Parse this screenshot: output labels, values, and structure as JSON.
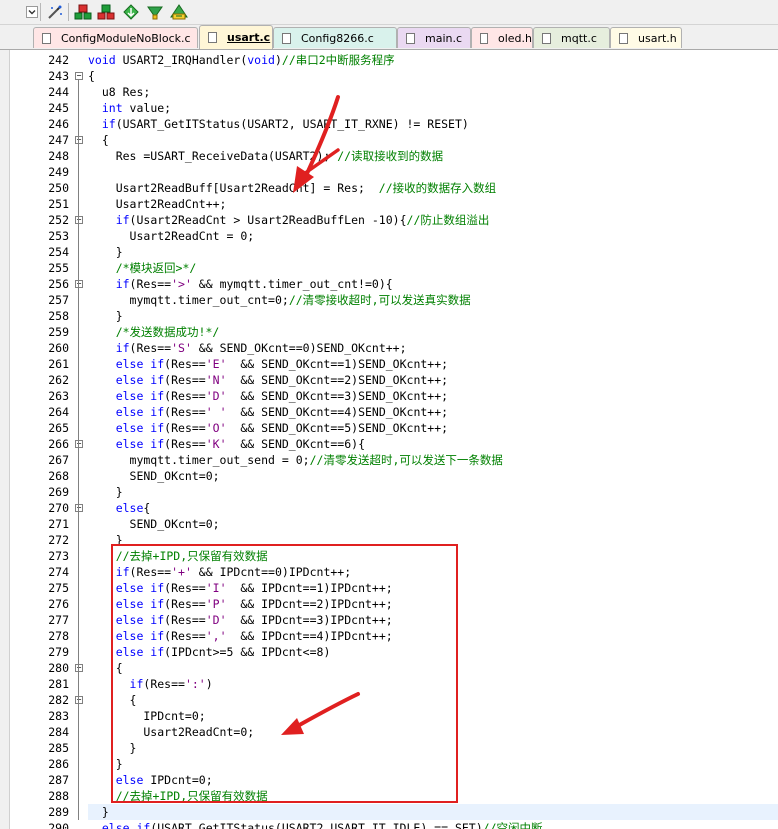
{
  "toolbar": {
    "icons": [
      "chevron-down-icon",
      "magic-wand-icon",
      "build-icon",
      "rebuild-icon",
      "download-icon",
      "debug-icon",
      "options-icon"
    ]
  },
  "tabs": [
    {
      "label": "ConfigModuleNoBlock.c",
      "color": "#ffe6e6",
      "active": false
    },
    {
      "label": "usart.c",
      "color": "#fff6d7",
      "active": true
    },
    {
      "label": "Config8266.c",
      "color": "#d9f2ec",
      "active": false
    },
    {
      "label": "main.c",
      "color": "#ead9f2",
      "active": false
    },
    {
      "label": "oled.h",
      "color": "#ffe6e6",
      "active": false
    },
    {
      "label": "mqtt.c",
      "color": "#e6eedd",
      "active": false
    },
    {
      "label": "usart.h",
      "color": "#fffbe6",
      "active": false
    }
  ],
  "editor": {
    "current_line": 289,
    "lines": [
      {
        "n": "242",
        "fold": "",
        "segs": [
          [
            "kw",
            "void "
          ],
          [
            "",
            "USART2_IRQHandler("
          ],
          [
            "kw",
            "void"
          ],
          [
            "",
            ")"
          ],
          [
            "cm",
            "//串口2中断服务程序"
          ]
        ]
      },
      {
        "n": "243",
        "fold": "-",
        "segs": [
          [
            "",
            "{"
          ]
        ]
      },
      {
        "n": "244",
        "fold": "",
        "segs": [
          [
            "",
            "  u8 Res;"
          ]
        ]
      },
      {
        "n": "245",
        "fold": "",
        "segs": [
          [
            "kw",
            "  int "
          ],
          [
            "",
            "value;"
          ]
        ]
      },
      {
        "n": "246",
        "fold": "",
        "segs": [
          [
            "kw",
            "  if"
          ],
          [
            "",
            "(USART_GetITStatus(USART2, USART_IT_RXNE) != RESET)"
          ]
        ]
      },
      {
        "n": "247",
        "fold": "-",
        "segs": [
          [
            "",
            "  {"
          ]
        ]
      },
      {
        "n": "248",
        "fold": "",
        "segs": [
          [
            "",
            "    Res =USART_ReceiveData(USART2); "
          ],
          [
            "cm",
            "//读取接收到的数据"
          ]
        ]
      },
      {
        "n": "249",
        "fold": "",
        "segs": [
          [
            "",
            ""
          ]
        ]
      },
      {
        "n": "250",
        "fold": "",
        "segs": [
          [
            "",
            "    Usart2ReadBuff[Usart2ReadCnt] = Res;  "
          ],
          [
            "cm",
            "//接收的数据存入数组"
          ]
        ]
      },
      {
        "n": "251",
        "fold": "",
        "segs": [
          [
            "",
            "    Usart2ReadCnt++;"
          ]
        ]
      },
      {
        "n": "252",
        "fold": "-",
        "segs": [
          [
            "kw",
            "    if"
          ],
          [
            "",
            "(Usart2ReadCnt > Usart2ReadBuffLen -"
          ],
          [
            "num",
            "10"
          ],
          [
            "",
            ")"
          ],
          [
            "",
            "{"
          ],
          [
            "cm",
            "//防止数组溢出"
          ]
        ]
      },
      {
        "n": "253",
        "fold": "",
        "segs": [
          [
            "",
            "      Usart2ReadCnt = "
          ],
          [
            "num",
            "0"
          ],
          [
            "",
            ";"
          ]
        ]
      },
      {
        "n": "254",
        "fold": "",
        "segs": [
          [
            "",
            "    }"
          ]
        ]
      },
      {
        "n": "255",
        "fold": "",
        "segs": [
          [
            "cm",
            "    /*模块返回>*/"
          ]
        ]
      },
      {
        "n": "256",
        "fold": "-",
        "segs": [
          [
            "kw",
            "    if"
          ],
          [
            "",
            "(Res=="
          ],
          [
            "str",
            "'>'"
          ],
          [
            "",
            " && mymqtt.timer_out_cnt!="
          ],
          [
            "num",
            "0"
          ],
          [
            "",
            ")"
          ],
          [
            "",
            "{"
          ]
        ]
      },
      {
        "n": "257",
        "fold": "",
        "segs": [
          [
            "",
            "      mymqtt.timer_out_cnt="
          ],
          [
            "num",
            "0"
          ],
          [
            "",
            ";"
          ],
          [
            "cm",
            "//清零接收超时,可以发送真实数据"
          ]
        ]
      },
      {
        "n": "258",
        "fold": "",
        "segs": [
          [
            "",
            "    }"
          ]
        ]
      },
      {
        "n": "259",
        "fold": "",
        "segs": [
          [
            "cm",
            "    /*发送数据成功!*/"
          ]
        ]
      },
      {
        "n": "260",
        "fold": "",
        "segs": [
          [
            "kw",
            "    if"
          ],
          [
            "",
            "(Res=="
          ],
          [
            "str",
            "'S'"
          ],
          [
            "",
            " && SEND_OKcnt=="
          ],
          [
            "num",
            "0"
          ],
          [
            "",
            ")SEND_OKcnt++;"
          ]
        ]
      },
      {
        "n": "261",
        "fold": "",
        "segs": [
          [
            "kw",
            "    else if"
          ],
          [
            "",
            "(Res=="
          ],
          [
            "str",
            "'E'"
          ],
          [
            "",
            "  && SEND_OKcnt=="
          ],
          [
            "num",
            "1"
          ],
          [
            "",
            ")SEND_OKcnt++;"
          ]
        ]
      },
      {
        "n": "262",
        "fold": "",
        "segs": [
          [
            "kw",
            "    else if"
          ],
          [
            "",
            "(Res=="
          ],
          [
            "str",
            "'N'"
          ],
          [
            "",
            "  && SEND_OKcnt=="
          ],
          [
            "num",
            "2"
          ],
          [
            "",
            ")SEND_OKcnt++;"
          ]
        ]
      },
      {
        "n": "263",
        "fold": "",
        "segs": [
          [
            "kw",
            "    else if"
          ],
          [
            "",
            "(Res=="
          ],
          [
            "str",
            "'D'"
          ],
          [
            "",
            "  && SEND_OKcnt=="
          ],
          [
            "num",
            "3"
          ],
          [
            "",
            ")SEND_OKcnt++;"
          ]
        ]
      },
      {
        "n": "264",
        "fold": "",
        "segs": [
          [
            "kw",
            "    else if"
          ],
          [
            "",
            "(Res=="
          ],
          [
            "str",
            "' '"
          ],
          [
            "",
            "  && SEND_OKcnt=="
          ],
          [
            "num",
            "4"
          ],
          [
            "",
            ")SEND_OKcnt++;"
          ]
        ]
      },
      {
        "n": "265",
        "fold": "",
        "segs": [
          [
            "kw",
            "    else if"
          ],
          [
            "",
            "(Res=="
          ],
          [
            "str",
            "'O'"
          ],
          [
            "",
            "  && SEND_OKcnt=="
          ],
          [
            "num",
            "5"
          ],
          [
            "",
            ")SEND_OKcnt++;"
          ]
        ]
      },
      {
        "n": "266",
        "fold": "-",
        "segs": [
          [
            "kw",
            "    else if"
          ],
          [
            "",
            "(Res=="
          ],
          [
            "str",
            "'K'"
          ],
          [
            "",
            "  && SEND_OKcnt=="
          ],
          [
            "num",
            "6"
          ],
          [
            "",
            ")"
          ],
          [
            "",
            "{"
          ]
        ]
      },
      {
        "n": "267",
        "fold": "",
        "segs": [
          [
            "",
            "      mymqtt.timer_out_send = "
          ],
          [
            "num",
            "0"
          ],
          [
            "",
            ";"
          ],
          [
            "cm",
            "//清零发送超时,可以发送下一条数据"
          ]
        ]
      },
      {
        "n": "268",
        "fold": "",
        "segs": [
          [
            "",
            "      SEND_OKcnt="
          ],
          [
            "num",
            "0"
          ],
          [
            "",
            ";"
          ]
        ]
      },
      {
        "n": "269",
        "fold": "",
        "segs": [
          [
            "",
            "    }"
          ]
        ]
      },
      {
        "n": "270",
        "fold": "-",
        "segs": [
          [
            "kw",
            "    else"
          ],
          [
            "",
            "{"
          ]
        ]
      },
      {
        "n": "271",
        "fold": "",
        "segs": [
          [
            "",
            "      SEND_OKcnt="
          ],
          [
            "num",
            "0"
          ],
          [
            "",
            ";"
          ]
        ]
      },
      {
        "n": "272",
        "fold": "",
        "segs": [
          [
            "",
            "    }"
          ]
        ]
      },
      {
        "n": "273",
        "fold": "",
        "segs": [
          [
            "cm",
            "    //去掉+IPD,只保留有效数据"
          ]
        ]
      },
      {
        "n": "274",
        "fold": "",
        "segs": [
          [
            "kw",
            "    if"
          ],
          [
            "",
            "(Res=="
          ],
          [
            "str",
            "'+'"
          ],
          [
            "",
            " && IPDcnt=="
          ],
          [
            "num",
            "0"
          ],
          [
            "",
            ")IPDcnt++;"
          ]
        ]
      },
      {
        "n": "275",
        "fold": "",
        "segs": [
          [
            "kw",
            "    else if"
          ],
          [
            "",
            "(Res=="
          ],
          [
            "str",
            "'I'"
          ],
          [
            "",
            "  && IPDcnt=="
          ],
          [
            "num",
            "1"
          ],
          [
            "",
            ")IPDcnt++;"
          ]
        ]
      },
      {
        "n": "276",
        "fold": "",
        "segs": [
          [
            "kw",
            "    else if"
          ],
          [
            "",
            "(Res=="
          ],
          [
            "str",
            "'P'"
          ],
          [
            "",
            "  && IPDcnt=="
          ],
          [
            "num",
            "2"
          ],
          [
            "",
            ")IPDcnt++;"
          ]
        ]
      },
      {
        "n": "277",
        "fold": "",
        "segs": [
          [
            "kw",
            "    else if"
          ],
          [
            "",
            "(Res=="
          ],
          [
            "str",
            "'D'"
          ],
          [
            "",
            "  && IPDcnt=="
          ],
          [
            "num",
            "3"
          ],
          [
            "",
            ")IPDcnt++;"
          ]
        ]
      },
      {
        "n": "278",
        "fold": "",
        "segs": [
          [
            "kw",
            "    else if"
          ],
          [
            "",
            "(Res=="
          ],
          [
            "str",
            "','"
          ],
          [
            "",
            "  && IPDcnt=="
          ],
          [
            "num",
            "4"
          ],
          [
            "",
            ")IPDcnt++;"
          ]
        ]
      },
      {
        "n": "279",
        "fold": "",
        "segs": [
          [
            "kw",
            "    else if"
          ],
          [
            "",
            "(IPDcnt>="
          ],
          [
            "num",
            "5"
          ],
          [
            "",
            " && IPDcnt<="
          ],
          [
            "num",
            "8"
          ],
          [
            "",
            ")"
          ]
        ]
      },
      {
        "n": "280",
        "fold": "-",
        "segs": [
          [
            "",
            "    {"
          ]
        ]
      },
      {
        "n": "281",
        "fold": "",
        "segs": [
          [
            "kw",
            "      if"
          ],
          [
            "",
            "(Res=="
          ],
          [
            "str",
            "':'"
          ],
          [
            "",
            ")"
          ]
        ]
      },
      {
        "n": "282",
        "fold": "-",
        "segs": [
          [
            "",
            "      {"
          ]
        ]
      },
      {
        "n": "283",
        "fold": "",
        "segs": [
          [
            "",
            "        IPDcnt="
          ],
          [
            "num",
            "0"
          ],
          [
            "",
            ";"
          ]
        ]
      },
      {
        "n": "284",
        "fold": "",
        "segs": [
          [
            "",
            "        Usart2ReadCnt="
          ],
          [
            "num",
            "0"
          ],
          [
            "",
            ";"
          ]
        ]
      },
      {
        "n": "285",
        "fold": "",
        "segs": [
          [
            "",
            "      }"
          ]
        ]
      },
      {
        "n": "286",
        "fold": "",
        "segs": [
          [
            "",
            "    }"
          ]
        ]
      },
      {
        "n": "287",
        "fold": "",
        "segs": [
          [
            "kw",
            "    else "
          ],
          [
            "",
            "IPDcnt="
          ],
          [
            "num",
            "0"
          ],
          [
            "",
            ";"
          ]
        ]
      },
      {
        "n": "288",
        "fold": "",
        "segs": [
          [
            "cm",
            "    //去掉+IPD,只保留有效数据"
          ]
        ]
      },
      {
        "n": "289",
        "fold": "",
        "segs": [
          [
            "",
            "  }"
          ]
        ]
      },
      {
        "n": "290",
        "fold": "",
        "segs": [
          [
            "kw",
            "  else if"
          ],
          [
            "",
            "(USART_GetITStatus(USART2,USART_IT_IDLE) == SET)"
          ],
          [
            "cm",
            "//空闲中断"
          ]
        ]
      }
    ]
  },
  "colors": {
    "keyword": "#0000ff",
    "comment": "#008000",
    "char_literal": "#800080",
    "annotation": "#e02020"
  }
}
